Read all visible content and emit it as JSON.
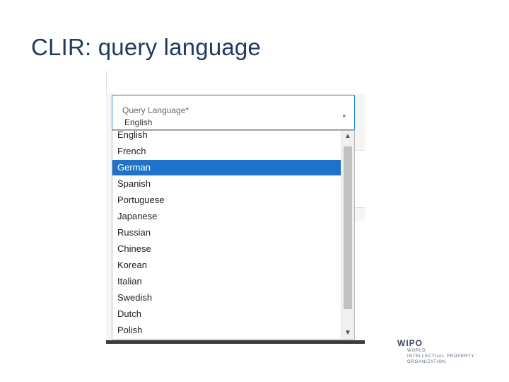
{
  "slide": {
    "title": "CLIR: query language"
  },
  "field": {
    "label": "Query Language*",
    "value": "English",
    "caret": "▾"
  },
  "dropdown": {
    "options": [
      "English",
      "French",
      "German",
      "Spanish",
      "Portuguese",
      "Japanese",
      "Russian",
      "Chinese",
      "Korean",
      "Italian",
      "Swedish",
      "Dutch",
      "Polish"
    ],
    "selected": "German",
    "scroll_up": "▲",
    "scroll_down": "▼"
  },
  "logo": {
    "mark": "WIPO",
    "line1": "WORLD",
    "line2": "INTELLECTUAL PROPERTY",
    "line3": "ORGANIZATION"
  },
  "colors": {
    "selected_bg": "#1e73c9",
    "field_border": "#1f8dd6",
    "title": "#1f3a5f"
  }
}
